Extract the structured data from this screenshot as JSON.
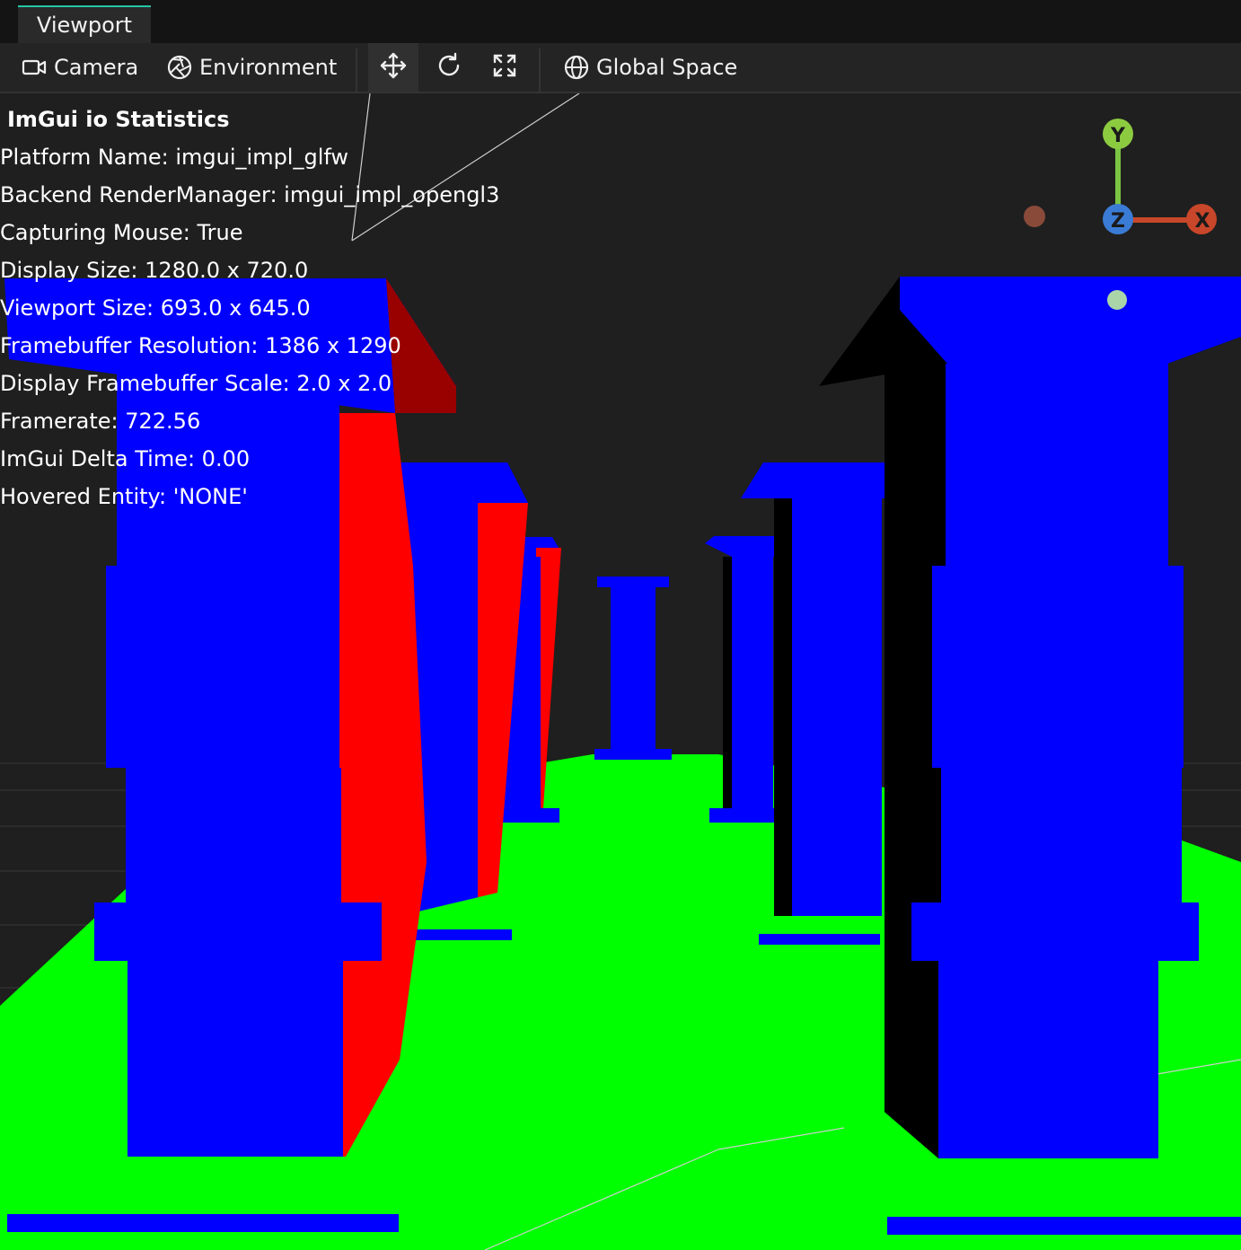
{
  "tab": {
    "label": "Viewport"
  },
  "toolbar": {
    "camera_label": "Camera",
    "environment_label": "Environment",
    "space_label": "Global Space"
  },
  "stats": {
    "title": "ImGui io Statistics",
    "lines": [
      "Platform Name: imgui_impl_glfw",
      "Backend RenderManager: imgui_impl_opengl3",
      "Capturing Mouse: True",
      "Display Size: 1280.0 x 720.0",
      "Viewport Size: 693.0 x 645.0",
      "Framebuffer Resolution: 1386 x 1290",
      "Display Framebuffer Scale: 2.0 x 2.0",
      "Framerate: 722.56",
      "ImGui Delta Time: 0.00",
      "Hovered Entity: 'NONE'"
    ]
  },
  "gizmo": {
    "y": "Y",
    "z": "Z",
    "x": "X"
  },
  "colors": {
    "accent": "#26c6a6",
    "floor": "#00ff00",
    "pillar": "#0000ff",
    "side": "#ff0000"
  }
}
